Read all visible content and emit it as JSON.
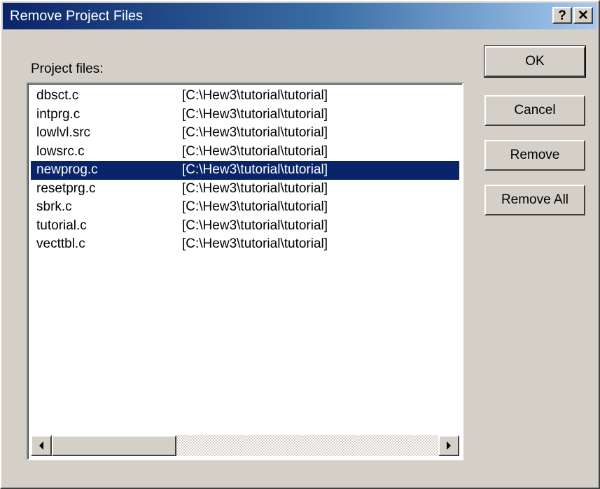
{
  "window": {
    "title": "Remove Project Files",
    "help_label": "?",
    "close_label": "✕"
  },
  "list": {
    "label": "Project files:",
    "items": [
      {
        "name": "dbsct.c",
        "path": "[C:\\Hew3\\tutorial\\tutorial]"
      },
      {
        "name": "intprg.c",
        "path": "[C:\\Hew3\\tutorial\\tutorial]"
      },
      {
        "name": "lowlvl.src",
        "path": "[C:\\Hew3\\tutorial\\tutorial]"
      },
      {
        "name": "lowsrc.c",
        "path": "[C:\\Hew3\\tutorial\\tutorial]"
      },
      {
        "name": "newprog.c",
        "path": "[C:\\Hew3\\tutorial\\tutorial]",
        "selected": true
      },
      {
        "name": "resetprg.c",
        "path": "[C:\\Hew3\\tutorial\\tutorial]"
      },
      {
        "name": "sbrk.c",
        "path": "[C:\\Hew3\\tutorial\\tutorial]"
      },
      {
        "name": "tutorial.c",
        "path": "[C:\\Hew3\\tutorial\\tutorial]"
      },
      {
        "name": "vecttbl.c",
        "path": "[C:\\Hew3\\tutorial\\tutorial]"
      }
    ]
  },
  "buttons": {
    "ok": "OK",
    "cancel": "Cancel",
    "remove": "Remove",
    "remove_all": "Remove All"
  },
  "icons": {
    "scroll_left": "left-arrow",
    "scroll_right": "right-arrow"
  }
}
